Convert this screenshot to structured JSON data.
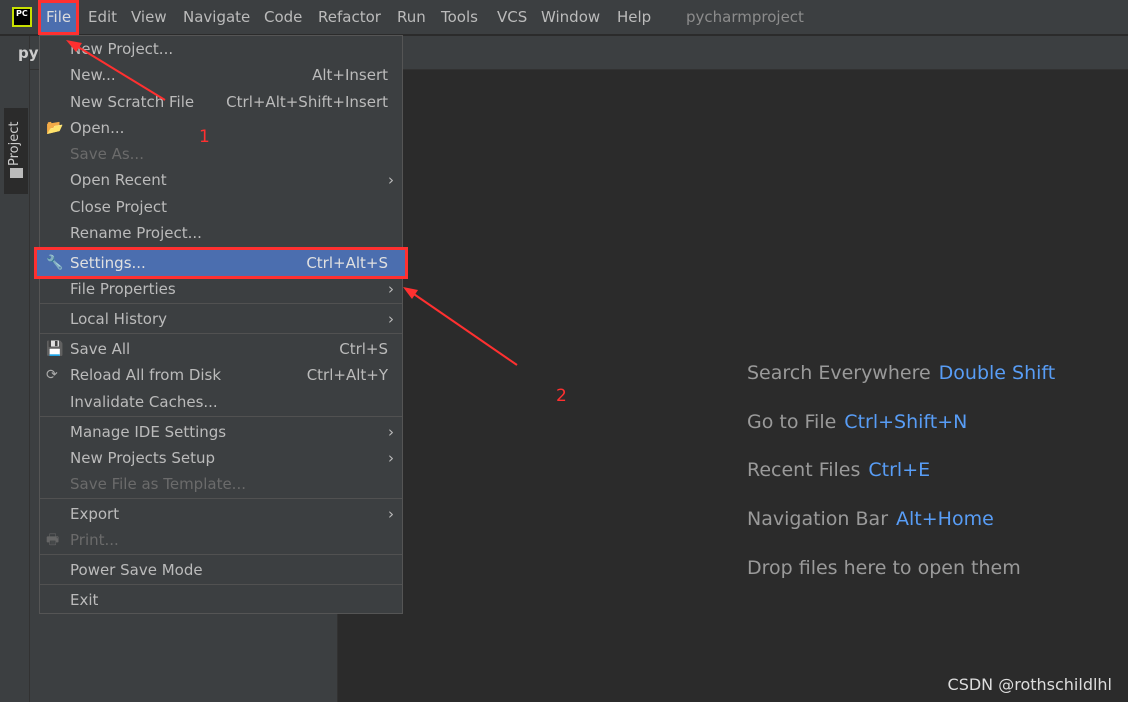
{
  "app": {
    "title": "pycharmproject",
    "logo": "PC",
    "project_tab_fragment": "pyc"
  },
  "menubar": [
    "File",
    "Edit",
    "View",
    "Navigate",
    "Code",
    "Refactor",
    "Run",
    "Tools",
    "VCS",
    "Window",
    "Help"
  ],
  "tool_window": {
    "project_label": "Project"
  },
  "file_menu": [
    {
      "label": "New Project...",
      "shortcut": ""
    },
    {
      "label": "New...",
      "shortcut": "Alt+Insert"
    },
    {
      "label": "New Scratch File",
      "shortcut": "Ctrl+Alt+Shift+Insert"
    },
    {
      "label": "Open...",
      "shortcut": "",
      "icon": "folder-open-icon"
    },
    {
      "label": "Save As...",
      "shortcut": "",
      "disabled": true
    },
    {
      "label": "Open Recent",
      "submenu": true
    },
    {
      "label": "Close Project"
    },
    {
      "label": "Rename Project..."
    },
    {
      "label": "Settings...",
      "shortcut": "Ctrl+Alt+S",
      "icon": "wrench-icon",
      "selected": true
    },
    {
      "label": "File Properties",
      "submenu": true
    },
    {
      "label": "Local History",
      "submenu": true
    },
    {
      "label": "Save All",
      "shortcut": "Ctrl+S",
      "icon": "save-icon"
    },
    {
      "label": "Reload All from Disk",
      "shortcut": "Ctrl+Alt+Y",
      "icon": "reload-icon"
    },
    {
      "label": "Invalidate Caches..."
    },
    {
      "label": "Manage IDE Settings",
      "submenu": true
    },
    {
      "label": "New Projects Setup",
      "submenu": true
    },
    {
      "label": "Save File as Template...",
      "disabled": true
    },
    {
      "label": "Export",
      "submenu": true
    },
    {
      "label": "Print...",
      "disabled": true,
      "icon": "print-icon"
    },
    {
      "label": "Power Save Mode"
    },
    {
      "label": "Exit"
    }
  ],
  "editor_hints": [
    {
      "label": "Search Everywhere",
      "key": "Double Shift"
    },
    {
      "label": "Go to File",
      "key": "Ctrl+Shift+N"
    },
    {
      "label": "Recent Files",
      "key": "Ctrl+E"
    },
    {
      "label": "Navigation Bar",
      "key": "Alt+Home"
    },
    {
      "label": "Drop files here to open them",
      "key": ""
    }
  ],
  "annotations": {
    "step1": "1",
    "step2": "2"
  },
  "watermark": "CSDN @rothschildlhl",
  "colors": {
    "accent": "#4b6eaf",
    "highlight_box": "#ff3030",
    "shortcut": "#589df6"
  }
}
